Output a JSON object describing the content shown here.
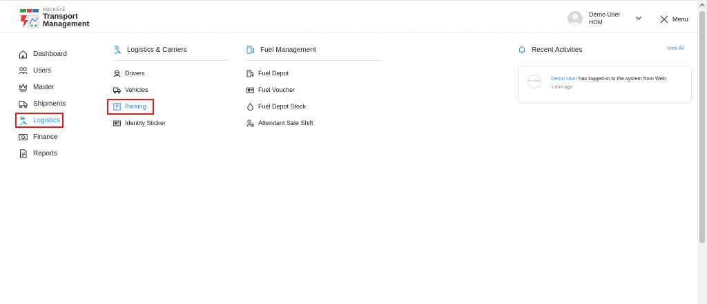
{
  "header": {
    "brand_small": "ROCKEYE",
    "brand_line1": "Transport",
    "brand_line2": "Management",
    "user_name": "Demo User",
    "user_role": "HOM",
    "menu_label": "Menu"
  },
  "sidebar": {
    "items": [
      {
        "label": "Dashboard",
        "icon": "home-icon"
      },
      {
        "label": "Users",
        "icon": "users-icon"
      },
      {
        "label": "Master",
        "icon": "crown-icon"
      },
      {
        "label": "Shipments",
        "icon": "truck-icon"
      },
      {
        "label": "Logistics",
        "icon": "logistics-icon",
        "active": true
      },
      {
        "label": "Finance",
        "icon": "finance-icon"
      },
      {
        "label": "Reports",
        "icon": "document-icon"
      }
    ]
  },
  "logistics_menu": {
    "title": "Logistics & Carriers",
    "items": [
      {
        "label": "Drivers",
        "icon": "driver-icon"
      },
      {
        "label": "Vehicles",
        "icon": "truck-icon"
      },
      {
        "label": "Parking",
        "icon": "parking-icon",
        "active": true
      },
      {
        "label": "Identity Sticker",
        "icon": "id-card-icon"
      }
    ]
  },
  "fuel_menu": {
    "title": "Fuel Management",
    "items": [
      {
        "label": "Fuel Depot",
        "icon": "fuel-pump-icon"
      },
      {
        "label": "Fuel Voucher",
        "icon": "voucher-icon"
      },
      {
        "label": "Fuel Depot Stock",
        "icon": "drop-icon"
      },
      {
        "label": "Attendant Sale Shift",
        "icon": "attendant-icon"
      }
    ]
  },
  "recent": {
    "title": "Recent Activities",
    "view_all": "View All",
    "no_image": "No Image",
    "activity_user": "Demo User",
    "activity_text": " has logged-in to the system from Web",
    "activity_time": "1 min ago"
  },
  "colors": {
    "accent": "#2e8fe0",
    "highlight": "#e01a1a",
    "content_bg": "#f3f4f7"
  }
}
